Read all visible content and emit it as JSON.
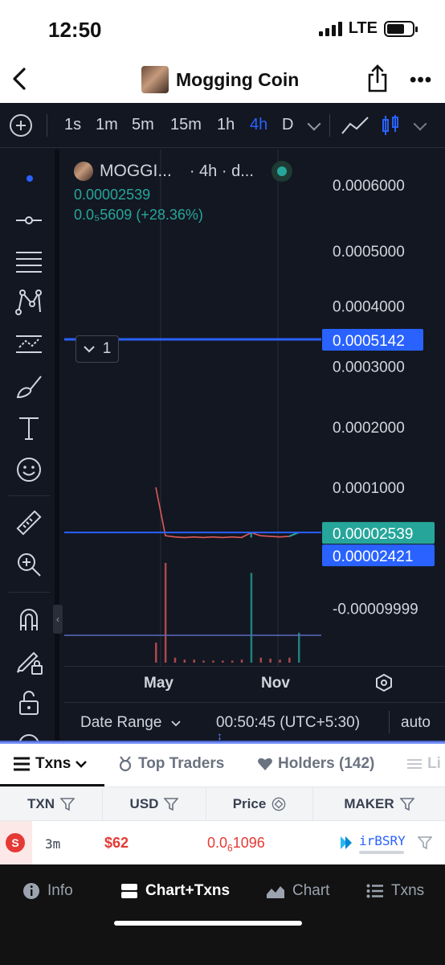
{
  "status_bar": {
    "time": "12:50",
    "network": "LTE"
  },
  "nav": {
    "title": "Mogging Coin",
    "more_label": "•••"
  },
  "toolbar": {
    "timeframes": [
      "1s",
      "1m",
      "5m",
      "15m",
      "1h",
      "4h",
      "D"
    ],
    "active_timeframe": "4h"
  },
  "legend": {
    "symbol": "MOGGI...",
    "interval": "· 4h · d...",
    "price": "0.00002539",
    "change": "0.0₅5609 (+28.36%)",
    "collapse_count": "1"
  },
  "price_axis": {
    "labels": [
      "0.0006000",
      "0.0005000",
      "0.0004000",
      "0.0003000",
      "0.0002000",
      "0.0001000",
      "-0.00009999"
    ],
    "current_price_tag": "0.00002539",
    "line_price_tag": "0.0005142",
    "secondary_price_tag": "0.00002421"
  },
  "chart_data": {
    "type": "line",
    "x_ticks": [
      "May",
      "Nov"
    ],
    "y_ticks": [
      -9.999e-05,
      0.0001,
      0.0002,
      0.0003,
      0.0004,
      0.0005,
      0.0006
    ],
    "horizontal_lines": [
      0.0005142,
      2.421e-05
    ],
    "last_price": 2.539e-05,
    "series": [
      {
        "x": [
          "May",
          "",
          "",
          "",
          "",
          "",
          "",
          "",
          "",
          "",
          "Nov",
          "",
          "",
          "",
          "",
          ""
        ],
        "values": [
          0.0001,
          2e-05,
          1.8e-05,
          1.7e-05,
          1.8e-05,
          1.7e-05,
          1.8e-05,
          1.7e-05,
          1.8e-05,
          1.7e-05,
          2.5e-05,
          2e-05,
          1.9e-05,
          1.8e-05,
          1.9e-05,
          2.539e-05
        ]
      }
    ],
    "volume": [
      0.2,
      1.0,
      0.05,
      0.03,
      0.03,
      0.02,
      0.02,
      0.02,
      0.02,
      0.03,
      0.9,
      0.05,
      0.04,
      0.03,
      0.05,
      0.3
    ]
  },
  "axis": {
    "x_labels": [
      "May",
      "Nov"
    ]
  },
  "datebar": {
    "date_range": "Date Range",
    "clock": "00:50:45 (UTC+5:30)",
    "scale": "auto"
  },
  "tabs": [
    {
      "label": "Txns"
    },
    {
      "label": "Top Traders"
    },
    {
      "label": "Holders (142)"
    },
    {
      "label": "Li"
    }
  ],
  "table": {
    "headers": [
      "TXN",
      "USD",
      "Price",
      "MAKER"
    ],
    "rows": [
      {
        "side": "S",
        "age": "3m",
        "usd": "$62",
        "price_prefix": "0.0",
        "price_sub": "6",
        "price_rest": "1096",
        "maker": "irBSRY"
      }
    ]
  },
  "bottom_nav": [
    {
      "label": "Info"
    },
    {
      "label": "Chart+Txns"
    },
    {
      "label": "Chart"
    },
    {
      "label": "Txns"
    }
  ],
  "colors": {
    "chart_bg": "#131722",
    "accent_blue": "#2962ff",
    "up_green": "#26a69a",
    "down_red": "#e53935"
  }
}
